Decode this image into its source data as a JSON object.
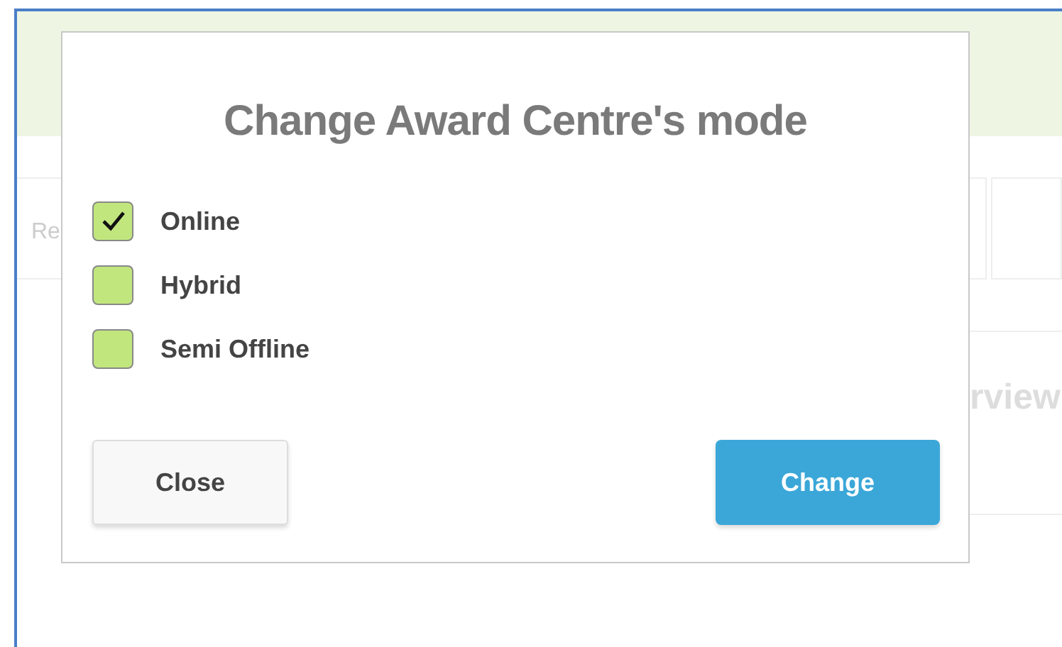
{
  "background": {
    "tab_fragment": "Re",
    "heading_fragment": "rview"
  },
  "dialog": {
    "title": "Change Award Centre's mode",
    "options": [
      {
        "label": "Online",
        "checked": true
      },
      {
        "label": "Hybrid",
        "checked": false
      },
      {
        "label": "Semi Offline",
        "checked": false
      }
    ],
    "buttons": [
      {
        "label": "Close",
        "kind": "secondary"
      },
      {
        "label": "Change",
        "kind": "primary"
      }
    ]
  }
}
